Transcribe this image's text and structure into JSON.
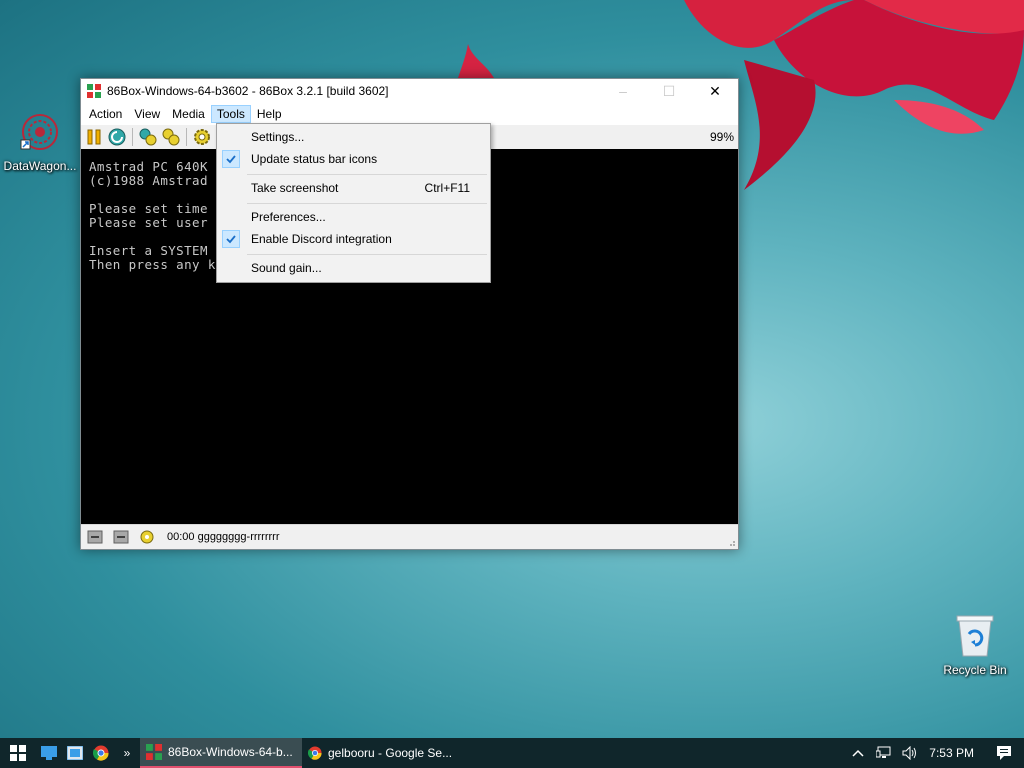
{
  "desktop": {
    "icons": [
      {
        "label": "DataWagon...",
        "icon": "datawagon-icon"
      },
      {
        "label": "Recycle Bin",
        "icon": "recycle-bin-icon"
      }
    ]
  },
  "window": {
    "title": "86Box-Windows-64-b3602 - 86Box 3.2.1 [build 3602]",
    "controls": {
      "minimize": "–",
      "maximize": "☐",
      "close": "✕"
    },
    "menu": [
      {
        "label": "Action"
      },
      {
        "label": "View"
      },
      {
        "label": "Media"
      },
      {
        "label": "Tools"
      },
      {
        "label": "Help"
      }
    ],
    "toolbar": {
      "buttons": [
        "pause-icon",
        "hard-reset-icon",
        "ctrl-alt-del-icon",
        "ctrl-alt-esc-icon",
        "settings-icon"
      ],
      "speed": "99%"
    },
    "screen_lines": [
      "Amstrad PC 640K",
      "(c)1988 Amstrad",
      "",
      "Please set time",
      "Please set user",
      "",
      "Insert a SYSTEM",
      "Then press any k"
    ],
    "status_bar": {
      "text": "00:00 gggggggg-rrrrrrrr"
    }
  },
  "tools_menu": {
    "items": [
      {
        "label": "Settings...",
        "checked": false,
        "shortcut": ""
      },
      {
        "label": "Update status bar icons",
        "checked": true,
        "shortcut": ""
      },
      {
        "label": "Take screenshot",
        "checked": false,
        "shortcut": "Ctrl+F11"
      },
      {
        "label": "Preferences...",
        "checked": false,
        "shortcut": ""
      },
      {
        "label": "Enable Discord integration",
        "checked": true,
        "shortcut": ""
      },
      {
        "label": "Sound gain...",
        "checked": false,
        "shortcut": ""
      }
    ]
  },
  "taskbar": {
    "buttons": [
      {
        "label": "86Box-Windows-64-b...",
        "active": true
      },
      {
        "label": "gelbooru - Google Se...",
        "active": false
      }
    ],
    "overflow": "»",
    "clock": "7:53 PM"
  },
  "colors": {
    "accent": "#cce8ff",
    "taskbar": "#10262b",
    "active_task_underline": "#e24f6e"
  }
}
